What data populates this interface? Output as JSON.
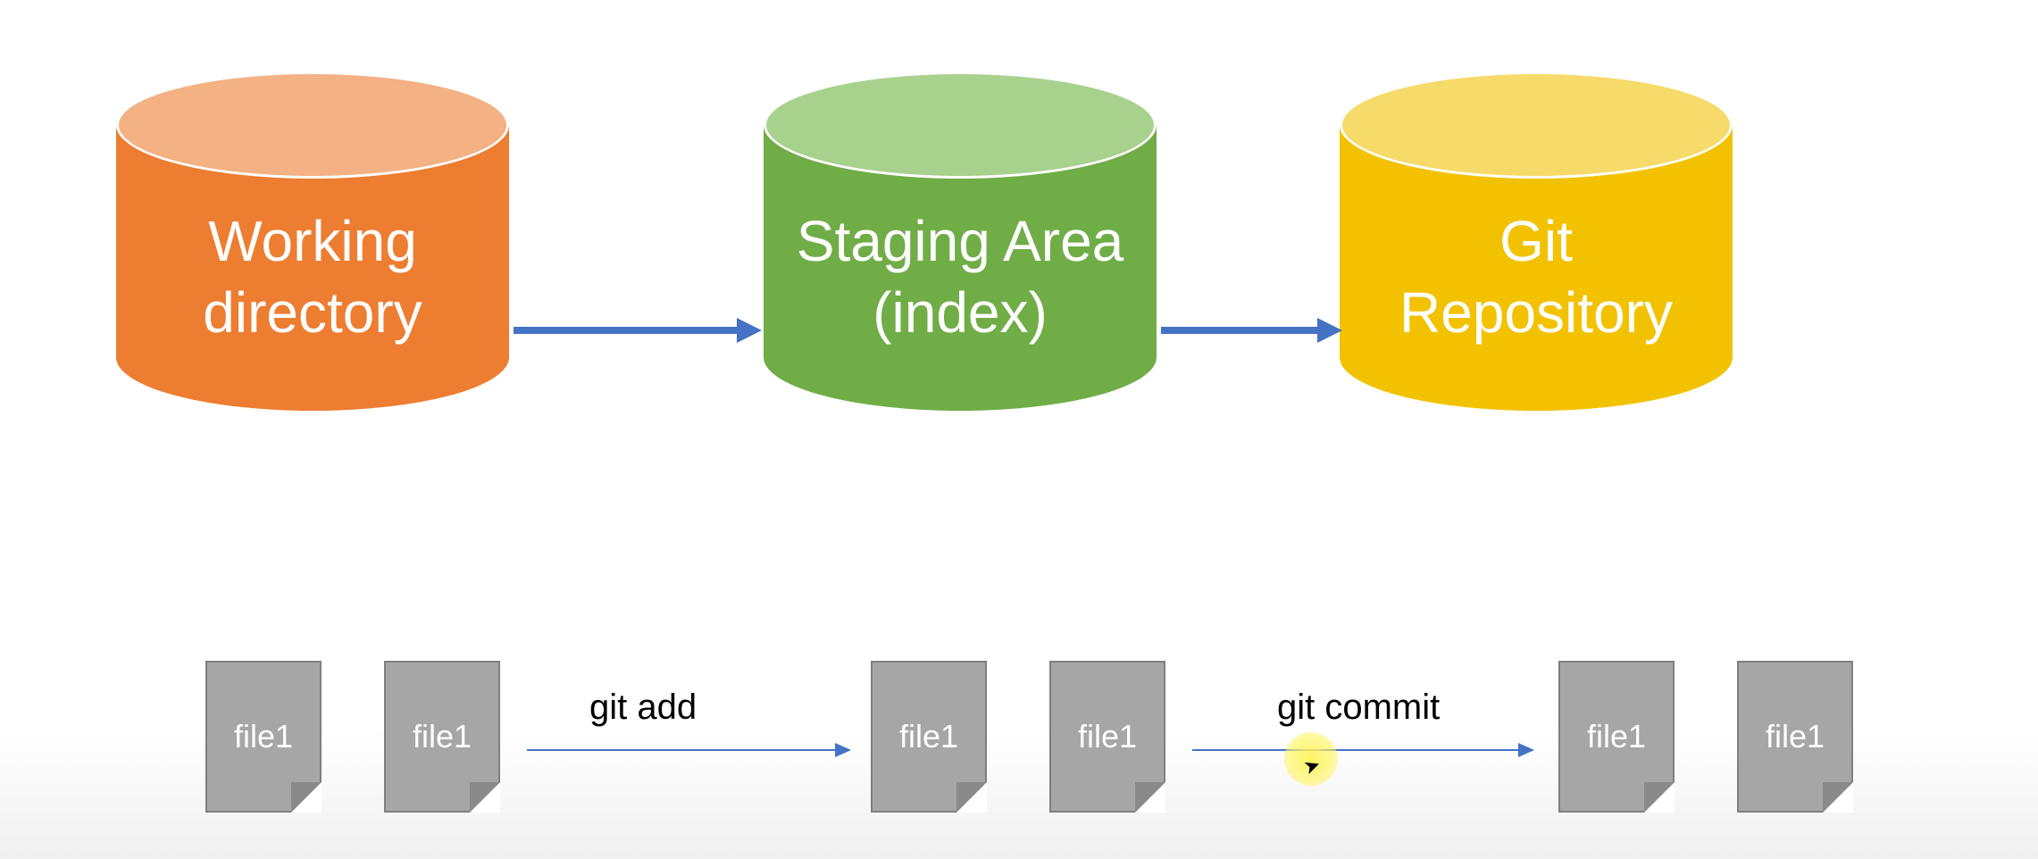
{
  "cylinders": {
    "working": {
      "line1": "Working",
      "line2": "directory"
    },
    "staging": {
      "line1": "Staging Area",
      "line2": "(index)"
    },
    "repo": {
      "line1": "Git",
      "line2": "Repository"
    }
  },
  "files": {
    "f1": "file1",
    "f2": "file1",
    "f3": "file1",
    "f4": "file1",
    "f5": "file1",
    "f6": "file1"
  },
  "commands": {
    "add": "git add",
    "commit": "git commit"
  }
}
